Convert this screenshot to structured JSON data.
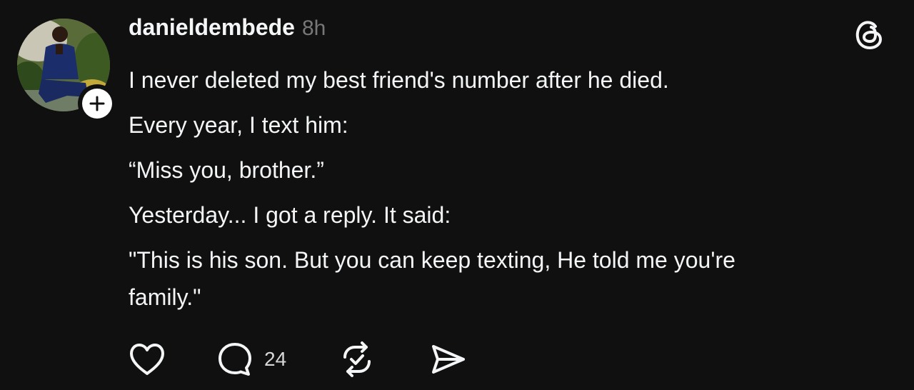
{
  "post": {
    "author": {
      "username": "danieldembede",
      "timestamp": "8h",
      "avatar_icon": "profile-photo",
      "follow_icon": "plus-icon"
    },
    "app_logo_icon": "threads-logo-icon",
    "lines": [
      "I never deleted my best friend's number after he died.",
      "Every year, I text him:",
      "“Miss you, brother.”",
      "Yesterday... I got a reply. It said:",
      "\"This is his son. But you can keep texting, He told me you're family.\""
    ],
    "actions": {
      "like_icon": "heart-icon",
      "reply_icon": "comment-icon",
      "reply_count": "24",
      "repost_icon": "repost-icon",
      "share_icon": "send-icon"
    }
  },
  "colors": {
    "background": "#101010",
    "text": "#f3f5f7",
    "muted": "#777777"
  }
}
